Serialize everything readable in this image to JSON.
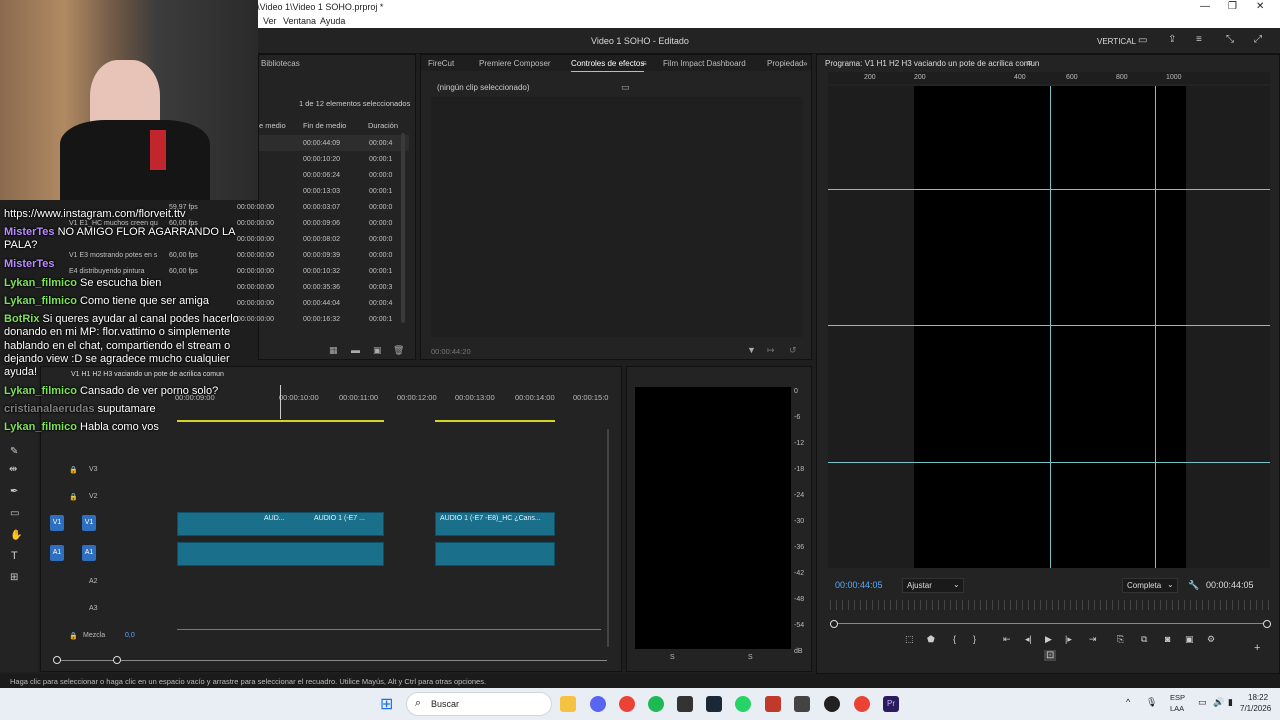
{
  "window": {
    "title": "Adobe Premiere Pro 2025 - F:\\Ads Alchemy\\SOHO\\07.01.26\\Video 1\\Video 1 SOHO.prproj *",
    "app_icon": "Pr"
  },
  "menu": {
    "items": [
      "Ver",
      "Ventana",
      "Ayuda"
    ]
  },
  "appbar": {
    "title": "Video 1 SOHO - Editado",
    "workspace": "VERTICAL"
  },
  "project": {
    "tab": "Bibliotecas",
    "selection": "1 de 12 elementos seleccionados",
    "columns": [
      "e medio",
      "Fin de medio",
      "Duración"
    ],
    "rows": [
      {
        "name": "",
        "fps": "",
        "start": "00:00",
        "end": "00:00:44:09",
        "dur": "00:00:4"
      },
      {
        "name": "",
        "fps": "",
        "start": "00:00",
        "end": "00:00:10:20",
        "dur": "00:00:1"
      },
      {
        "name": "",
        "fps": "",
        "start": "00:00",
        "end": "00:00:06:24",
        "dur": "00:00:0"
      },
      {
        "name": "",
        "fps": "",
        "start": "00:00",
        "end": "00:00:13:03",
        "dur": "00:00:1"
      },
      {
        "name": "",
        "fps": "59,97 fps",
        "start": "00:00:00:00",
        "end": "00:00:03:07",
        "dur": "00:00:0"
      },
      {
        "name": "V1 E1_HC muchos creen qu",
        "fps": "60,00 fps",
        "start": "00:00:00:00",
        "end": "00:00:09:06",
        "dur": "00:00:0"
      },
      {
        "name": "",
        "fps": "",
        "start": "00:00:00:00",
        "end": "00:00:08:02",
        "dur": "00:00:0"
      },
      {
        "name": "V1 E3 mostrando potes en s",
        "fps": "60,00 fps",
        "start": "00:00:00:00",
        "end": "00:00:09:39",
        "dur": "00:00:0"
      },
      {
        "name": "E4 distribuyendo pintura",
        "fps": "60,00 fps",
        "start": "00:00:00:00",
        "end": "00:00:10:32",
        "dur": "00:00:1"
      },
      {
        "name": "",
        "fps": "",
        "start": "00:00:00:00",
        "end": "00:00:35:36",
        "dur": "00:00:3"
      },
      {
        "name": "",
        "fps": "",
        "start": "00:00:00:00",
        "end": "00:00:44:04",
        "dur": "00:00:4"
      },
      {
        "name": "",
        "fps": "",
        "start": "00:00:00:00",
        "end": "00:00:16:32",
        "dur": "00:00:1"
      }
    ]
  },
  "effects": {
    "tabs": [
      "FireCut",
      "Premiere Composer",
      "Controles de efectos",
      "Film Impact Dashboard",
      "Propiedad"
    ],
    "active_tab": "Controles de efectos",
    "empty_msg": "(ningún clip seleccionado)",
    "timecode": "00:00:44:20"
  },
  "program": {
    "title": "Programa: V1 H1 H2 H3 vaciando un pote de acrilica comun",
    "ruler": [
      "200",
      "200",
      "400",
      "600",
      "800",
      "1000",
      "1200"
    ],
    "timecode_left": "00:00:44:05",
    "fit": "Ajustar",
    "quality": "Completa",
    "timecode_right": "00:00:44:05"
  },
  "timeline": {
    "title": "V1 H1 H2 H3 vaciando un pote de acrilica comun",
    "ruler": [
      "00:00:09:00",
      "00:00:10:00",
      "00:00:11:00",
      "00:00:12:00",
      "00:00:13:00",
      "00:00:14:00",
      "00:00:15:0"
    ],
    "tracks": [
      "V3",
      "V2",
      "V1",
      "A1",
      "A2",
      "A3"
    ],
    "mix_label": "Mezcla",
    "mix_value": "0,0",
    "clips": [
      {
        "label": "AUD..."
      },
      {
        "label": "AUDIO 1 (-E7 ..."
      },
      {
        "label": "AUDIO 1 (-E7 -E8)_HC ¿Cans..."
      }
    ]
  },
  "meter": {
    "scale": [
      "0",
      "-6",
      "-12",
      "-18",
      "-24",
      "-30",
      "-36",
      "-42",
      "-48",
      "-54",
      "dB"
    ],
    "labels": [
      "S",
      "S"
    ]
  },
  "status": "Haga clic para seleccionar o haga clic en un espacio vacío y arrastre para seleccionar el recuadro. Utilice Mayús, Alt y Ctrl para otras opciones.",
  "taskbar": {
    "search": "Buscar",
    "lang": "ESP",
    "region": "LAA",
    "time": "18:22",
    "date": "7/1/2026"
  },
  "chat": [
    {
      "name": "",
      "text": "https://www.instagram.com/florveit.ttv"
    },
    {
      "name": "MisterTes",
      "text": "NO AMIGO FLOR AGARRANDO LA"
    },
    {
      "name": "",
      "text": "PALA?"
    },
    {
      "name": "MisterTes",
      "text": ""
    },
    {
      "name": "Lykan_filmico",
      "text": "Se escucha bien"
    },
    {
      "name": "Lykan_filmico",
      "text": "Como tiene que ser amiga"
    },
    {
      "name": "BotRix",
      "text": "Si queres ayudar al canal podes hacerlo"
    },
    {
      "name": "",
      "text": "donando en mi MP: flor.vattimo o simplemente"
    },
    {
      "name": "",
      "text": "hablando en el chat, compartiendo el stream o"
    },
    {
      "name": "",
      "text": "dejando view :D se agradece mucho cualquier"
    },
    {
      "name": "",
      "text": "ayuda!"
    },
    {
      "name": "Lykan_filmico",
      "text": "Cansado de ver porno solo?"
    },
    {
      "name": "cristianalaerudas",
      "text": "suputamare"
    },
    {
      "name": "Lykan_filmico",
      "text": "Habla como vos"
    }
  ]
}
